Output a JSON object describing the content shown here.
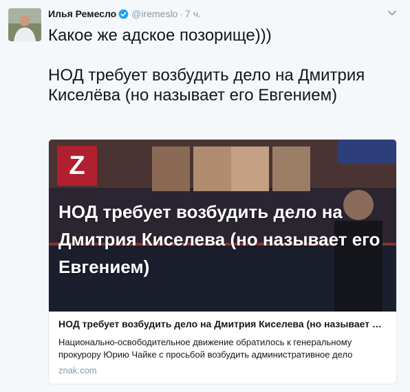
{
  "tweet": {
    "author_name": "Илья Ремесло",
    "handle": "@iremeslo",
    "separator": "·",
    "time": "7 ч.",
    "text_line1": "Какое же адское позорище)))",
    "text_line2": "НОД требует возбудить дело на Дмитрия Киселёва (но называет его Евгением)"
  },
  "card": {
    "logo_letter": "Z",
    "image_headline": "НОД требует возбудить дело на Дмитрия Киселева (но называет его Евгением)",
    "title": "НОД требует возбудить дело на Дмитрия Киселева (но называет его Евгением)",
    "description_line1": "Национально-освободительное движение обратилось к генеральному",
    "description_line2": "прокурору Юрию Чайке с просьбой возбудить административное дело",
    "domain": "znak.com"
  },
  "colors": {
    "background": "#f5f8fa",
    "verified": "#1da1f2",
    "muted": "#8899a6",
    "logo_red": "#b0202e"
  },
  "icons": {
    "verified": "verified-badge-icon",
    "caret": "chevron-down-icon"
  }
}
